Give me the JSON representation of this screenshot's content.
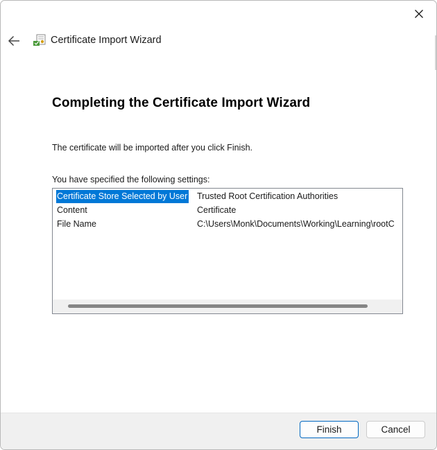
{
  "window": {
    "title": "Certificate Import Wizard"
  },
  "icons": {
    "back": "back-arrow-icon",
    "close": "close-icon",
    "wizard": "certificate-wizard-icon"
  },
  "main": {
    "heading": "Completing the Certificate Import Wizard",
    "intro": "The certificate will be imported after you click Finish.",
    "settings_label": "You have specified the following settings:"
  },
  "settings": {
    "rows": [
      {
        "key": "Certificate Store Selected by User",
        "value": "Trusted Root Certification Authorities",
        "selected": true
      },
      {
        "key": "Content",
        "value": "Certificate",
        "selected": false
      },
      {
        "key": "File Name",
        "value": "C:\\Users\\Monk\\Documents\\Working\\Learning\\rootC",
        "selected": false
      }
    ]
  },
  "footer": {
    "finish_label": "Finish",
    "cancel_label": "Cancel"
  },
  "colors": {
    "selection": "#0078d7",
    "primary_button_border": "#0067c0",
    "footer_background": "#f0f0f0"
  }
}
